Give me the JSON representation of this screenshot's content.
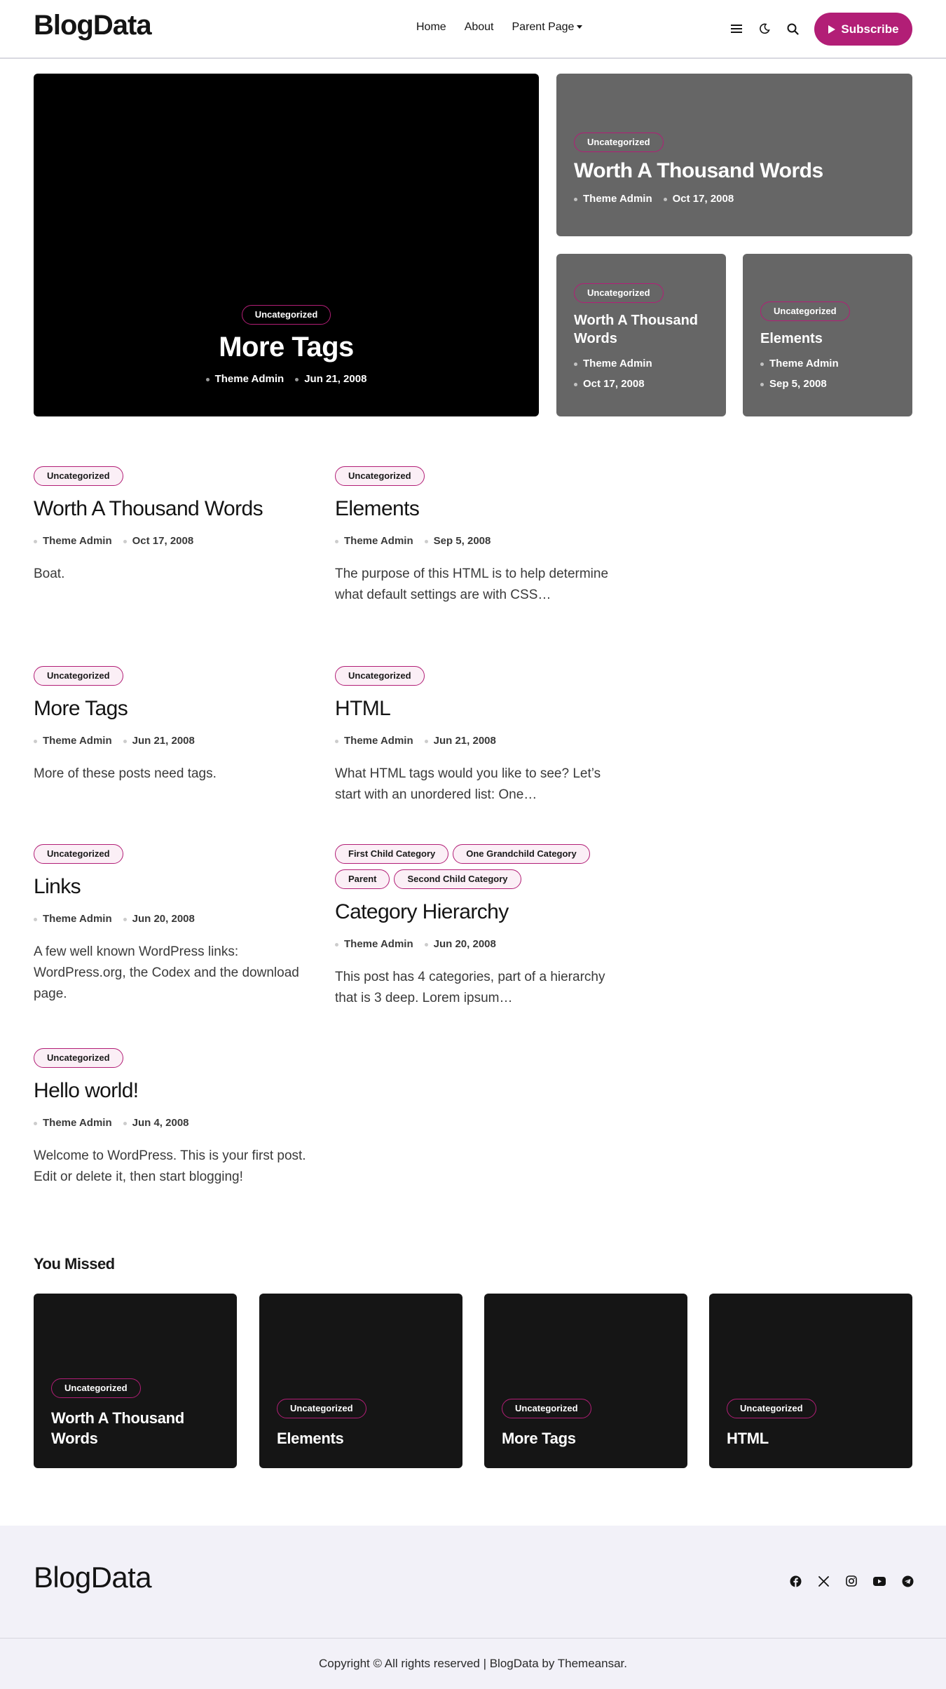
{
  "header": {
    "logo": "BlogData",
    "nav": [
      {
        "label": "Home"
      },
      {
        "label": "About"
      },
      {
        "label": "Parent Page"
      }
    ],
    "subscribe_label": "Subscribe",
    "icons": [
      "menu-icon",
      "moon-icon",
      "search-icon",
      "play-icon"
    ]
  },
  "hero": {
    "main": {
      "category": "Uncategorized",
      "title": "More Tags",
      "author": "Theme Admin",
      "date": "Jun 21, 2008"
    },
    "top_right": {
      "category": "Uncategorized",
      "title": "Worth A Thousand Words",
      "author": "Theme Admin",
      "date": "Oct 17, 2008"
    },
    "bottom_left": {
      "category": "Uncategorized",
      "title": "Worth A Thousand Words",
      "author": "Theme Admin",
      "date": "Oct 17, 2008"
    },
    "bottom_right": {
      "category": "Uncategorized",
      "title": "Elements",
      "author": "Theme Admin",
      "date": "Sep 5, 2008"
    }
  },
  "posts": [
    {
      "categories": [
        "Uncategorized"
      ],
      "title": "Worth A Thousand Words",
      "author": "Theme Admin",
      "date": "Oct 17, 2008",
      "excerpt": "Boat."
    },
    {
      "categories": [
        "Uncategorized"
      ],
      "title": "Elements",
      "author": "Theme Admin",
      "date": "Sep 5, 2008",
      "excerpt": "The purpose of this HTML is to help determine what default settings are with CSS…"
    },
    {
      "categories": [
        "Uncategorized"
      ],
      "title": "More Tags",
      "author": "Theme Admin",
      "date": "Jun 21, 2008",
      "excerpt": "More of these posts need tags."
    },
    {
      "categories": [
        "Uncategorized"
      ],
      "title": "HTML",
      "author": "Theme Admin",
      "date": "Jun 21, 2008",
      "excerpt": "What HTML tags would you like to see? Let’s start with an unordered list: One…"
    },
    {
      "categories": [
        "Uncategorized"
      ],
      "title": "Links",
      "author": "Theme Admin",
      "date": "Jun 20, 2008",
      "excerpt": "A few well known WordPress links: WordPress.org, the Codex and the download page."
    },
    {
      "categories": [
        "First Child Category",
        "One Grandchild Category",
        "Parent",
        "Second Child Category"
      ],
      "title": "Category Hierarchy",
      "author": "Theme Admin",
      "date": "Jun 20, 2008",
      "excerpt": "This post has 4 categories, part of a hierarchy that is 3 deep. Lorem ipsum…"
    },
    {
      "categories": [
        "Uncategorized"
      ],
      "title": "Hello world!",
      "author": "Theme Admin",
      "date": "Jun 4, 2008",
      "excerpt": "Welcome to WordPress. This is your first post. Edit or delete it, then start blogging!"
    }
  ],
  "you_missed": {
    "heading": "You Missed",
    "cards": [
      {
        "category": "Uncategorized",
        "title": "Worth A Thousand Words"
      },
      {
        "category": "Uncategorized",
        "title": "Elements"
      },
      {
        "category": "Uncategorized",
        "title": "More Tags"
      },
      {
        "category": "Uncategorized",
        "title": "HTML"
      }
    ]
  },
  "footer": {
    "logo": "BlogData",
    "social_icons": [
      "facebook-icon",
      "x-icon",
      "instagram-icon",
      "youtube-icon",
      "telegram-icon"
    ],
    "copyright": "Copyright © All rights reserved | BlogData by Themeansar."
  },
  "colors": {
    "accent": "#b21e76",
    "hero_grey": "#666666",
    "card_dark": "#151515",
    "footer_bg": "#f2f1f8"
  }
}
